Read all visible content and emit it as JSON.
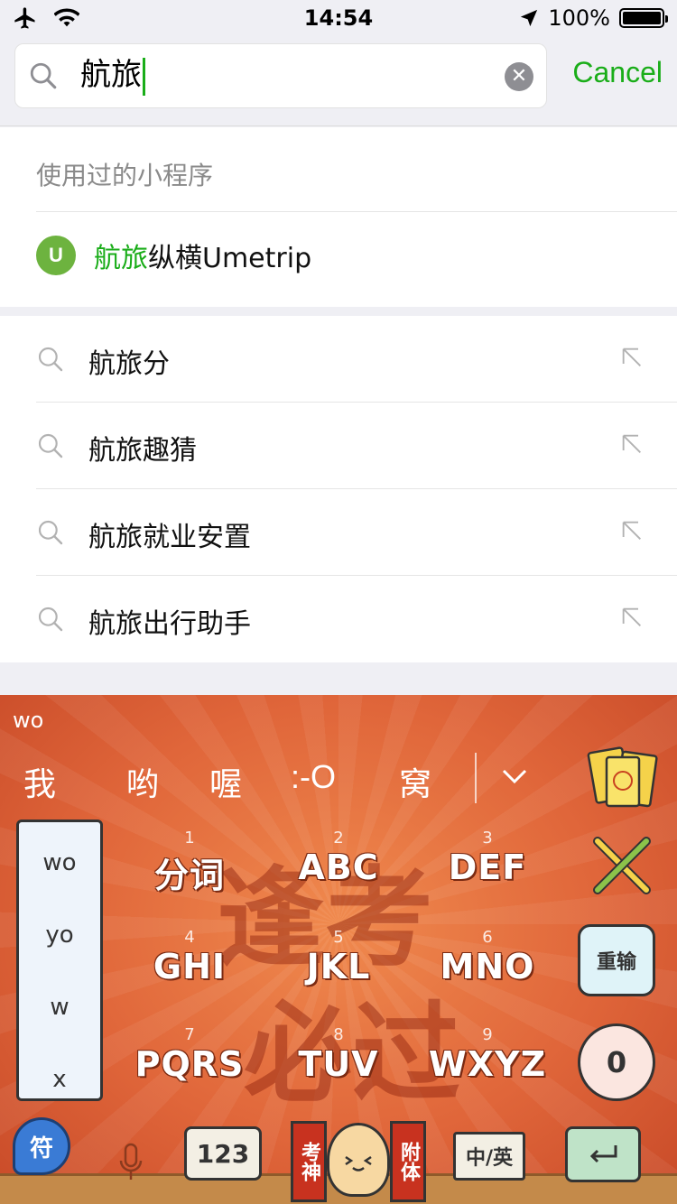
{
  "status_bar": {
    "time": "14:54",
    "battery": "100%"
  },
  "search": {
    "query": "航旅",
    "cancel_label": "Cancel"
  },
  "recent": {
    "title": "使用过的小程序",
    "app": {
      "logo_text": "U",
      "name_highlight": "航旅",
      "name_rest": "纵横Umetrip"
    }
  },
  "suggestions": [
    {
      "text": "航旅分"
    },
    {
      "text": "航旅趣猜"
    },
    {
      "text": "航旅就业安置"
    },
    {
      "text": "航旅出行助手"
    }
  ],
  "keyboard": {
    "pinyin": "wo",
    "candidates": [
      "我",
      "哟",
      "喔",
      ":-O",
      "窝"
    ],
    "keys": [
      {
        "num": "1",
        "letters": "分词"
      },
      {
        "num": "2",
        "letters": "ABC"
      },
      {
        "num": "3",
        "letters": "DEF"
      },
      {
        "num": "4",
        "letters": "GHI"
      },
      {
        "num": "5",
        "letters": "JKL"
      },
      {
        "num": "6",
        "letters": "MNO"
      },
      {
        "num": "7",
        "letters": "PQRS"
      },
      {
        "num": "8",
        "letters": "TUV"
      },
      {
        "num": "9",
        "letters": "WXYZ"
      }
    ],
    "pinyin_list": [
      "wo",
      "yo",
      "w",
      "x"
    ],
    "side": {
      "symbol": "符",
      "reinput": "重输",
      "zero": "0"
    },
    "bottom": {
      "symbol": "符",
      "num": "123",
      "exam_left": "考神",
      "exam_right": "附体",
      "lang": "中/英"
    },
    "watermark": [
      "逢考",
      "必过"
    ]
  }
}
